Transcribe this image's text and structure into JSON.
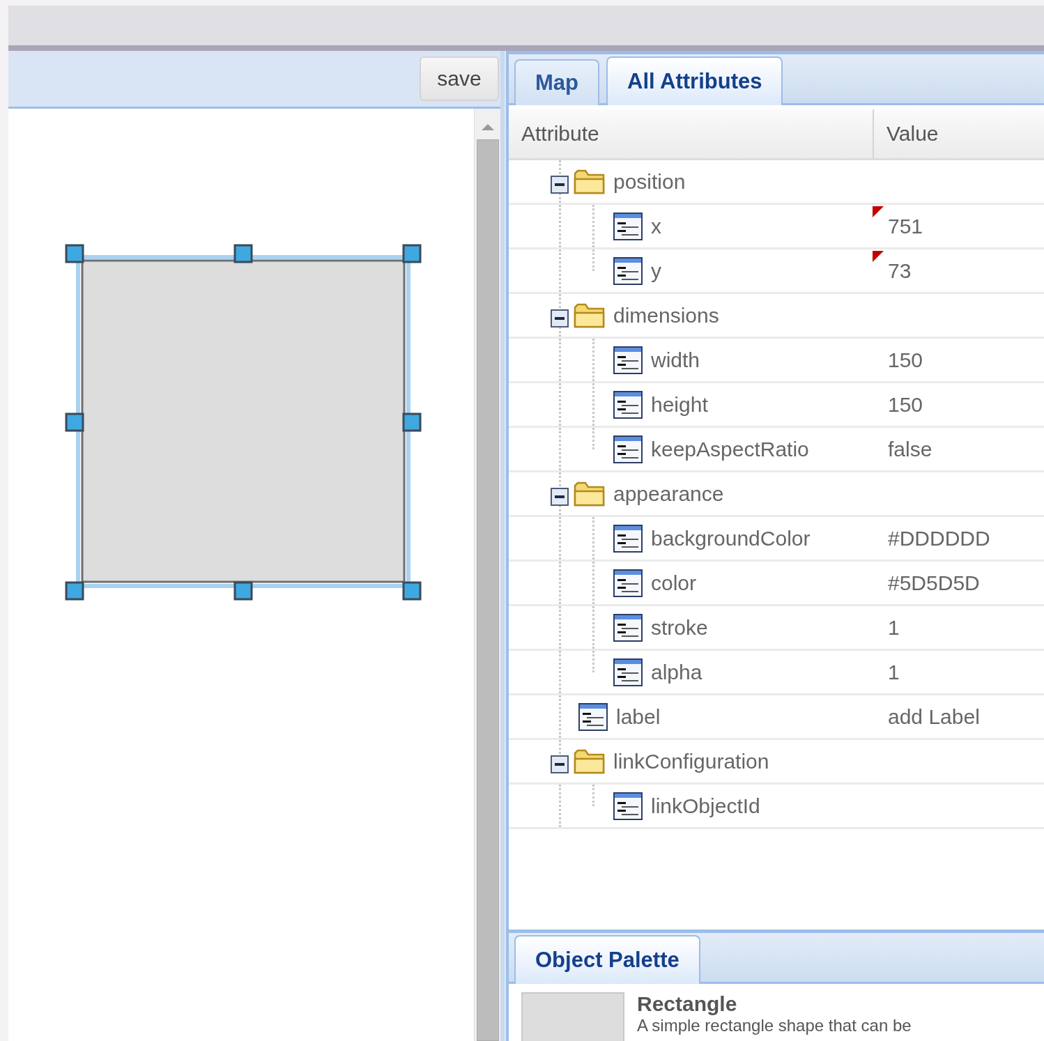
{
  "toolbar": {
    "save_button": "save"
  },
  "tabs": [
    {
      "label": "Map",
      "selected": false
    },
    {
      "label": "All Attributes",
      "selected": true
    }
  ],
  "table": {
    "columns": [
      "Attribute",
      "Value"
    ],
    "rows": [
      {
        "kind": "group",
        "name": "position",
        "expanded": true,
        "children": [
          {
            "kind": "attribute",
            "name": "x",
            "value": "751",
            "modified": true
          },
          {
            "kind": "attribute",
            "name": "y",
            "value": "73",
            "modified": true
          }
        ]
      },
      {
        "kind": "group",
        "name": "dimensions",
        "expanded": true,
        "children": [
          {
            "kind": "attribute",
            "name": "width",
            "value": "150",
            "modified": false
          },
          {
            "kind": "attribute",
            "name": "height",
            "value": "150",
            "modified": false
          },
          {
            "kind": "attribute",
            "name": "keepAspectRatio",
            "value": "false",
            "modified": false
          }
        ]
      },
      {
        "kind": "group",
        "name": "appearance",
        "expanded": true,
        "children": [
          {
            "kind": "attribute",
            "name": "backgroundColor",
            "value": "#DDDDDD",
            "modified": false
          },
          {
            "kind": "attribute",
            "name": "color",
            "value": "#5D5D5D",
            "modified": false
          },
          {
            "kind": "attribute",
            "name": "stroke",
            "value": "1",
            "modified": false
          },
          {
            "kind": "attribute",
            "name": "alpha",
            "value": "1",
            "modified": false
          }
        ]
      },
      {
        "kind": "attribute",
        "name": "label",
        "value": "add Label",
        "modified": false
      },
      {
        "kind": "group",
        "name": "linkConfiguration",
        "expanded": true,
        "children": [
          {
            "kind": "attribute",
            "name": "linkObjectId",
            "modified": false
          }
        ]
      }
    ]
  },
  "palette": {
    "tab": {
      "label": "Object Palette",
      "selected": true
    },
    "items": [
      {
        "title": "Rectangle",
        "description": "A simple rectangle shape that can be"
      }
    ]
  }
}
